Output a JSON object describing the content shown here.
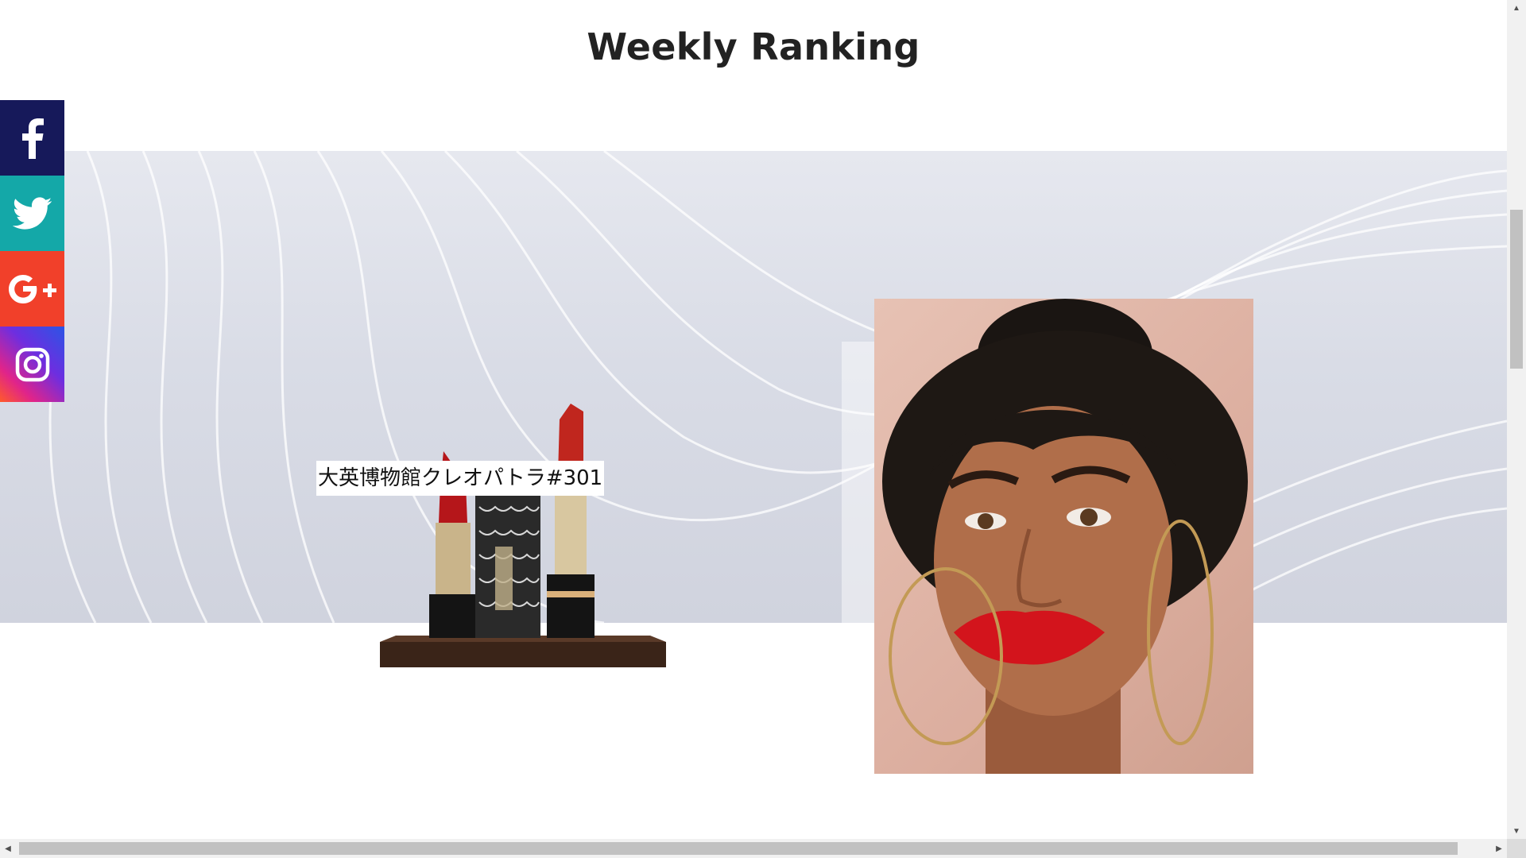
{
  "page": {
    "title": "Weekly Ranking"
  },
  "social": {
    "items": [
      {
        "name": "facebook",
        "icon": "facebook-icon",
        "color": "#16195a"
      },
      {
        "name": "twitter",
        "icon": "twitter-icon",
        "color": "#14a8a8"
      },
      {
        "name": "google-plus",
        "icon": "google-plus-icon",
        "color": "#f1402a"
      },
      {
        "name": "instagram",
        "icon": "instagram-icon",
        "color": "#6d2ee0"
      }
    ]
  },
  "ranking": {
    "product": {
      "label": "大英博物館クレオパトラ#301",
      "image": "lipstick-set-image"
    },
    "feature_image": "model-portrait-image"
  },
  "colors": {
    "title": "#222222",
    "banner": "#d9dce6",
    "lipstick": "#b5161a"
  }
}
